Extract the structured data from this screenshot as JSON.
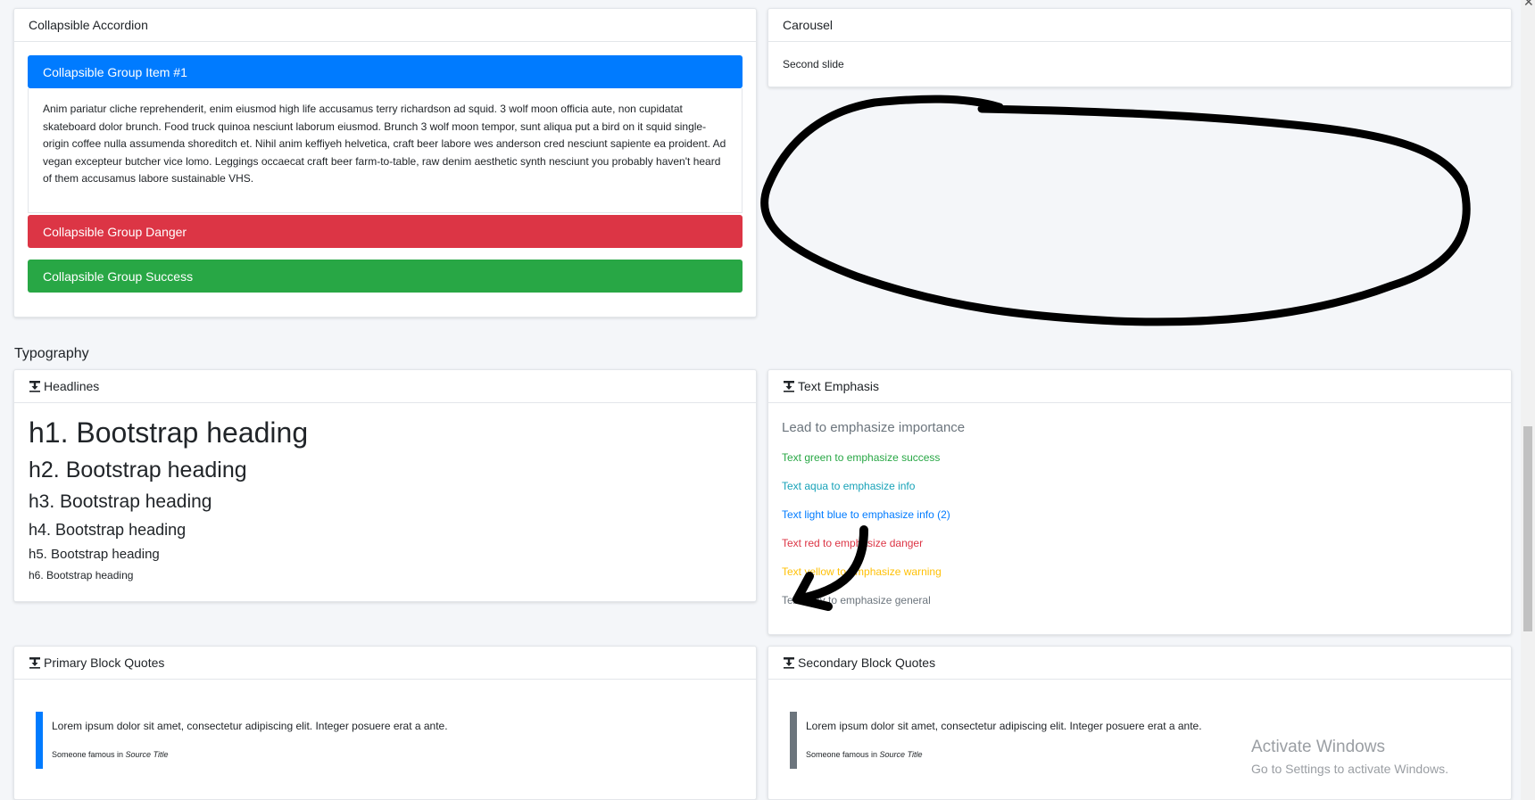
{
  "accordion": {
    "title": "Collapsible Accordion",
    "item1_label": "Collapsible Group Item #1",
    "item1_body": "Anim pariatur cliche reprehenderit, enim eiusmod high life accusamus terry richardson ad squid. 3 wolf moon officia aute, non cupidatat skateboard dolor brunch. Food truck quinoa nesciunt laborum eiusmod. Brunch 3 wolf moon tempor, sunt aliqua put a bird on it squid single-origin coffee nulla assumenda shoreditch et. Nihil anim keffiyeh helvetica, craft beer labore wes anderson cred nesciunt sapiente ea proident. Ad vegan excepteur butcher vice lomo. Leggings occaecat craft beer farm-to-table, raw denim aesthetic synth nesciunt you probably haven't heard of them accusamus labore sustainable VHS.",
    "danger_label": "Collapsible Group Danger",
    "success_label": "Collapsible Group Success",
    "colors": {
      "primary": "#007bff",
      "danger": "#dc3545",
      "success": "#28a745"
    }
  },
  "carousel": {
    "title": "Carousel",
    "slide_text": "Second slide"
  },
  "typography": {
    "section_title": "Typography",
    "headlines": {
      "title": "Headlines",
      "h1": "h1. Bootstrap heading",
      "h2": "h2. Bootstrap heading",
      "h3": "h3. Bootstrap heading",
      "h4": "h4. Bootstrap heading",
      "h5": "h5. Bootstrap heading",
      "h6": "h6. Bootstrap heading"
    },
    "emphasis": {
      "title": "Text Emphasis",
      "lead": "Lead to emphasize importance",
      "green": "Text green to emphasize success",
      "aqua": "Text aqua to emphasize info",
      "light_blue": "Text light blue to emphasize info (2)",
      "red": "Text red to emphasize danger",
      "yellow": "Text yellow to emphasize warning",
      "gray": "Text gray to emphasize general",
      "colors": {
        "green": "#28a745",
        "aqua": "#17a2b8",
        "light_blue": "#007bff",
        "red": "#dc3545",
        "yellow": "#ffc107",
        "gray": "#6c757d"
      }
    },
    "primary_quotes": {
      "title": "Primary Block Quotes",
      "text": "Lorem ipsum dolor sit amet, consectetur adipiscing elit. Integer posuere erat a ante.",
      "footer_prefix": "Someone famous in ",
      "footer_source": "Source Title",
      "bar_color": "#007bff"
    },
    "secondary_quotes": {
      "title": "Secondary Block Quotes",
      "text": "Lorem ipsum dolor sit amet, consectetur adipiscing elit. Integer posuere erat a ante.",
      "footer_prefix": "Someone famous in ",
      "footer_source": "Source Title",
      "bar_color": "#6c757d"
    }
  },
  "watermark": {
    "line1": "Activate Windows",
    "line2": "Go to Settings to activate Windows."
  },
  "icons": {
    "card_header_icon": "text-height-icon",
    "close_icon": "close-icon"
  }
}
